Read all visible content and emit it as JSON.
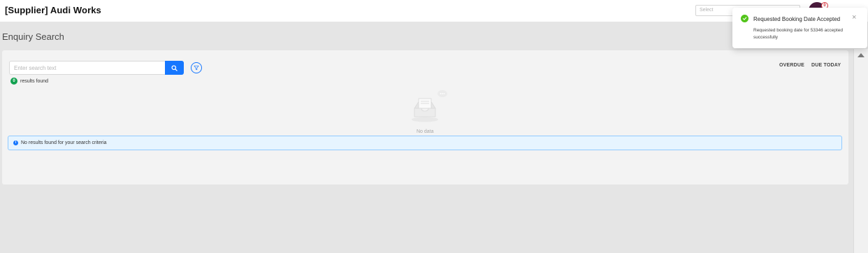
{
  "header": {
    "app_title": "[Supplier] Audi Works",
    "select_placeholder": "Select",
    "notification_count": "0"
  },
  "page": {
    "heading": "Enquiry Search"
  },
  "search": {
    "placeholder": "Enter search text",
    "results_count": "0",
    "results_label": "results found"
  },
  "quick_filters": {
    "overdue": "OVERDUE",
    "due_today": "DUE TODAY"
  },
  "empty_state": {
    "text": "No data"
  },
  "alert": {
    "text": "No results found for your search criteria"
  },
  "toast": {
    "title": "Requested Booking Date Accepted",
    "body": "Requested booking date for 53346 accepted successfully",
    "close_glyph": "×"
  },
  "colors": {
    "primary": "#1677ff",
    "success": "#52c41a",
    "badge_green": "#12a150",
    "page_bg": "#e5e5e5",
    "card_bg": "#f3f3f3",
    "alert_bg": "#e6f4ff",
    "alert_border": "#91caff"
  },
  "icons": {
    "search": "search-icon",
    "filter": "filter-icon",
    "empty": "empty-inbox-icon",
    "info": "info-icon",
    "success": "check-circle-icon",
    "close": "close-icon"
  }
}
